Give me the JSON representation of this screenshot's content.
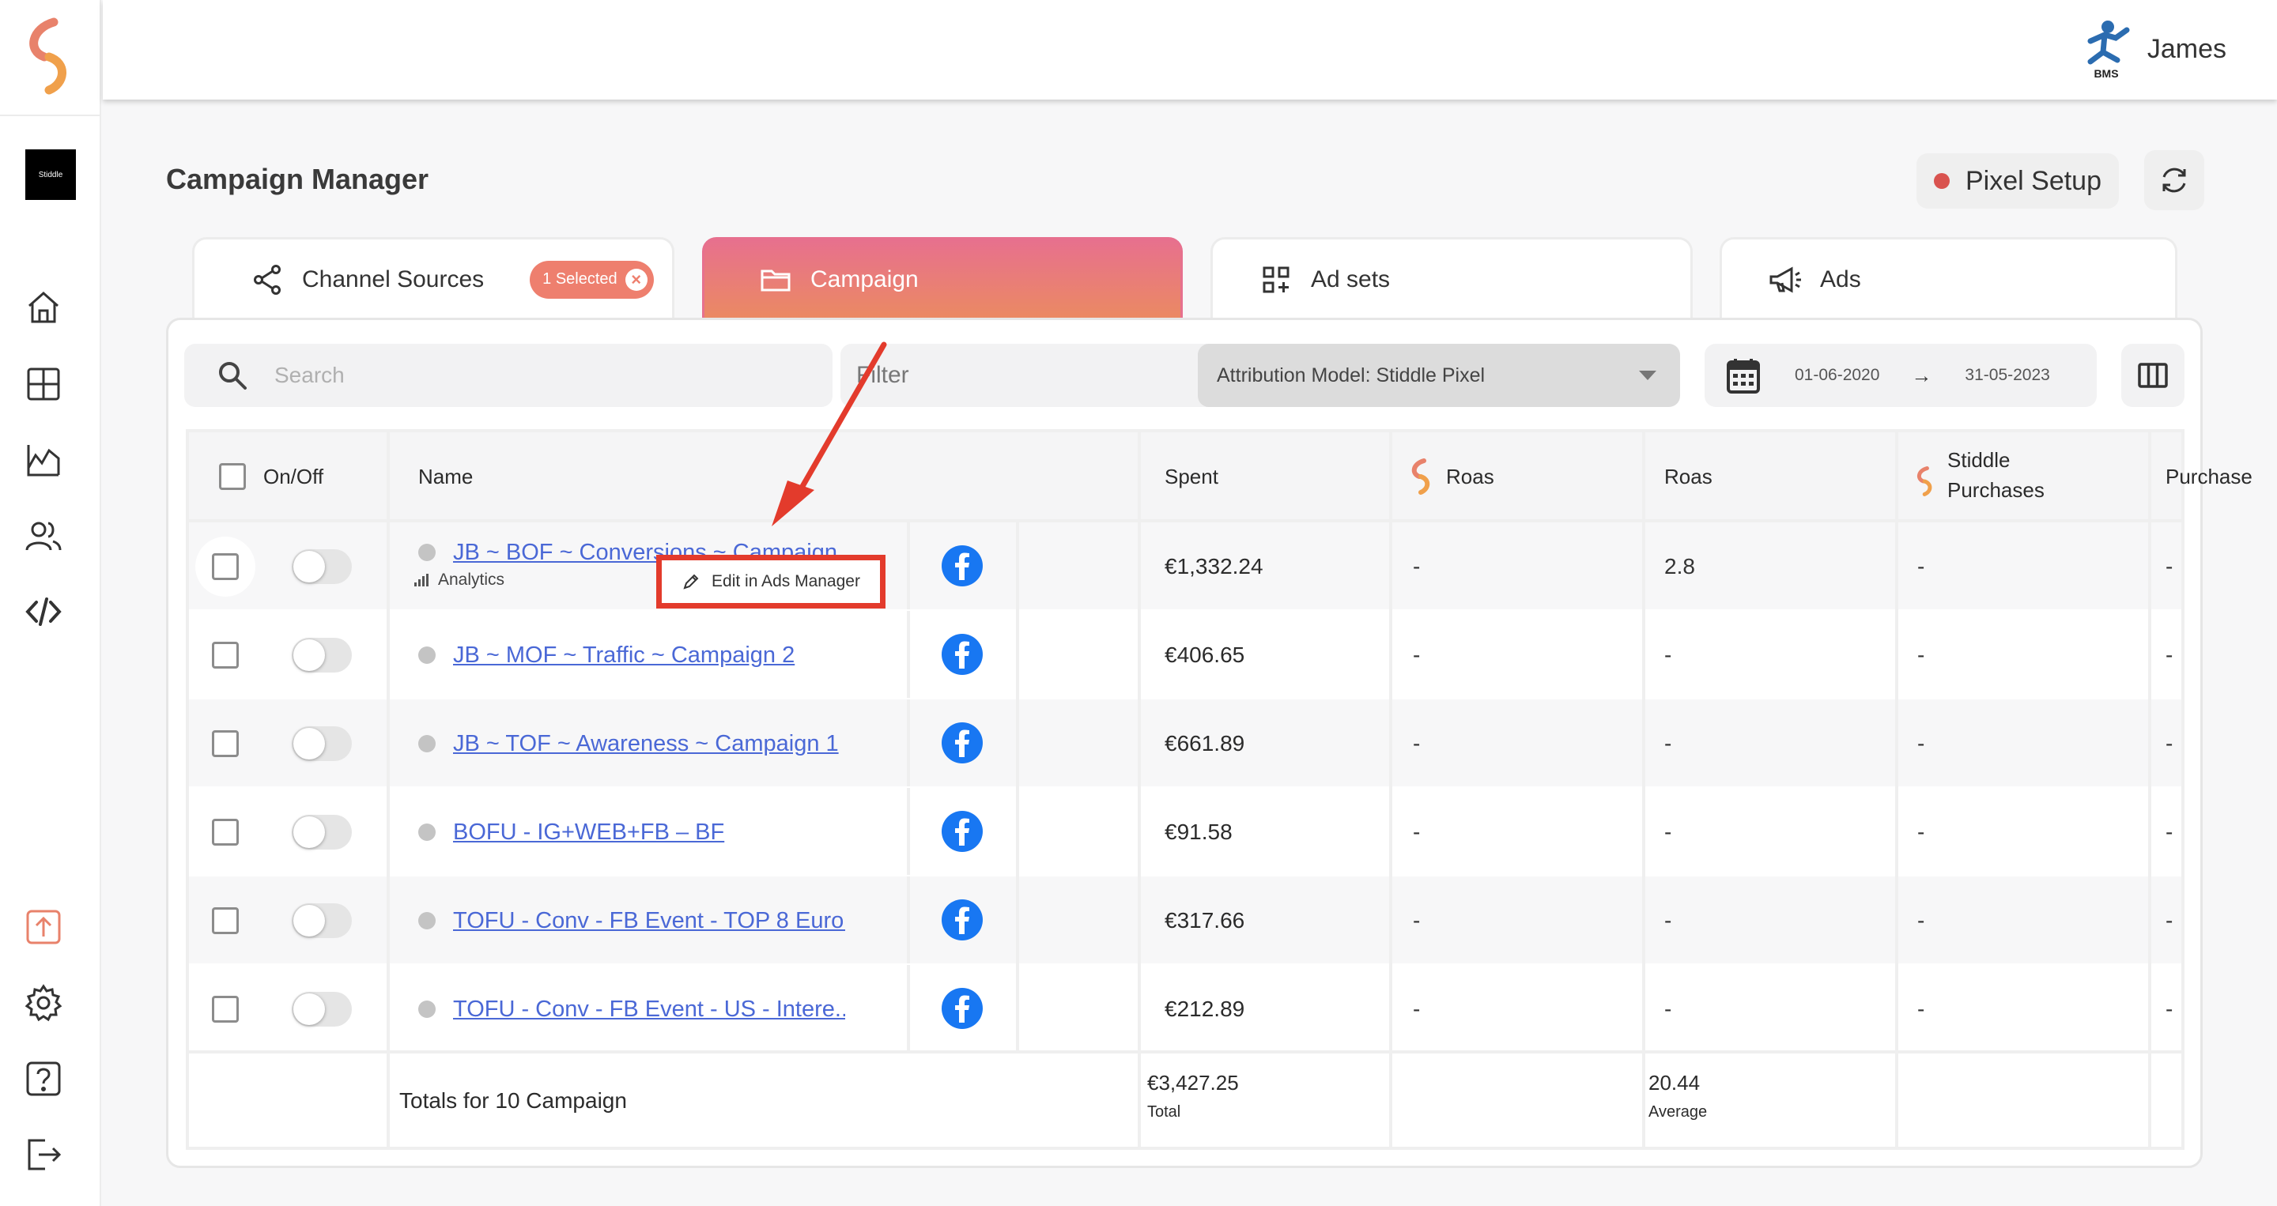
{
  "user": {
    "name": "James",
    "avatar_label": "BMS"
  },
  "brand_badge": "Stiddle",
  "page_title": "Campaign Manager",
  "pixel_setup_label": "Pixel Setup",
  "tabs": [
    {
      "label": "Channel Sources",
      "icon": "share-icon",
      "badge": "1 Selected"
    },
    {
      "label": "Campaign",
      "icon": "folder-icon"
    },
    {
      "label": "Ad sets",
      "icon": "grid-plus-icon"
    },
    {
      "label": "Ads",
      "icon": "megaphone-icon"
    }
  ],
  "toolbar": {
    "search_placeholder": "Search",
    "filter_label": "Filter",
    "attribution_label": "Attribution Model: Stiddle Pixel",
    "date_from": "01-06-2020",
    "date_to": "31-05-2023"
  },
  "table": {
    "headers": {
      "onoff": "On/Off",
      "name": "Name",
      "spent": "Spent",
      "stiddle_roas": "Roas",
      "roas": "Roas",
      "stiddle_purchases": "Stiddle Purchases",
      "purchase": "Purchase"
    },
    "rows": [
      {
        "name": "JB ~ BOF ~ Conversions ~ Campaign",
        "spent": "€1,332.24",
        "stiddle_roas": "-",
        "roas": "2.8",
        "stiddle_purchases": "-",
        "purchase": "-"
      },
      {
        "name": "JB ~ MOF ~ Traffic ~ Campaign 2",
        "spent": "€406.65",
        "stiddle_roas": "-",
        "roas": "-",
        "stiddle_purchases": "-",
        "purchase": "-"
      },
      {
        "name": "JB ~ TOF ~ Awareness ~ Campaign 1",
        "spent": "€661.89",
        "stiddle_roas": "-",
        "roas": "-",
        "stiddle_purchases": "-",
        "purchase": "-"
      },
      {
        "name": "BOFU - IG+WEB+FB – BF",
        "spent": "€91.58",
        "stiddle_roas": "-",
        "roas": "-",
        "stiddle_purchases": "-",
        "purchase": "-"
      },
      {
        "name": "TOFU - Conv - FB Event - TOP 8 Euro...",
        "spent": "€317.66",
        "stiddle_roas": "-",
        "roas": "-",
        "stiddle_purchases": "-",
        "purchase": "-"
      },
      {
        "name": "TOFU - Conv - FB Event - US - Intere...",
        "spent": "€212.89",
        "stiddle_roas": "-",
        "roas": "-",
        "stiddle_purchases": "-",
        "purchase": "-"
      }
    ],
    "row_hover": {
      "analytics_label": "Analytics",
      "edit_label": "Edit in Ads Manager"
    },
    "totals": {
      "label": "Totals for 10 Campaign",
      "spent": "€3,427.25",
      "spent_caption": "Total",
      "roas": "20.44",
      "roas_caption": "Average"
    }
  },
  "colors": {
    "accent_gradient_top": "#e7708e",
    "accent_gradient_bottom": "#eb8a62",
    "link": "#4a68d6",
    "annotation_red": "#e33b2c",
    "facebook": "#1877f2"
  }
}
